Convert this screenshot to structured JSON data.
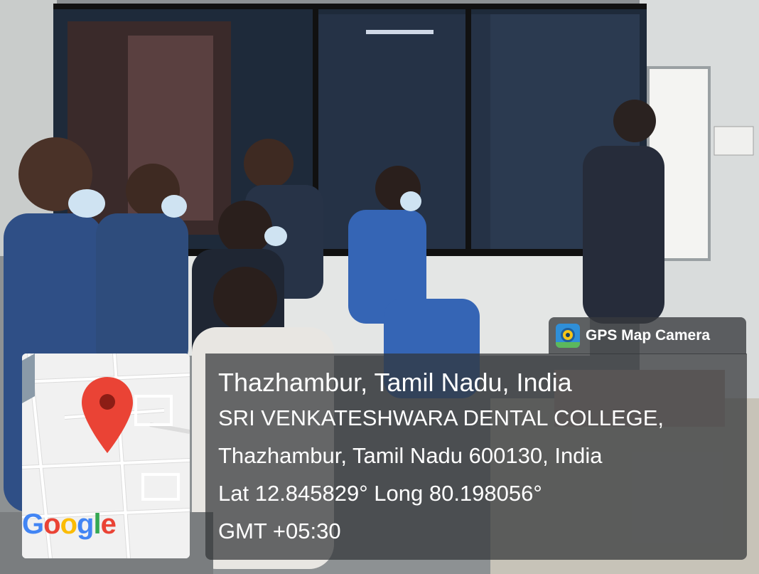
{
  "gps_badge": {
    "app_name": "GPS Map Camera",
    "icon": "gps-map-camera-app-icon"
  },
  "map": {
    "icon": "map-pin-icon",
    "pin_color": "#ea4335",
    "provider_logo": [
      "G",
      "o",
      "o",
      "g",
      "l",
      "e"
    ]
  },
  "location": {
    "title": "Thazhambur, Tamil Nadu, India",
    "address_line_1": "SRI VENKATESHWARA DENTAL COLLEGE,",
    "address_line_2": "Thazhambur, Tamil Nadu 600130, India",
    "coordinates": "Lat 12.845829° Long 80.198056°",
    "timezone": "GMT +05:30"
  }
}
